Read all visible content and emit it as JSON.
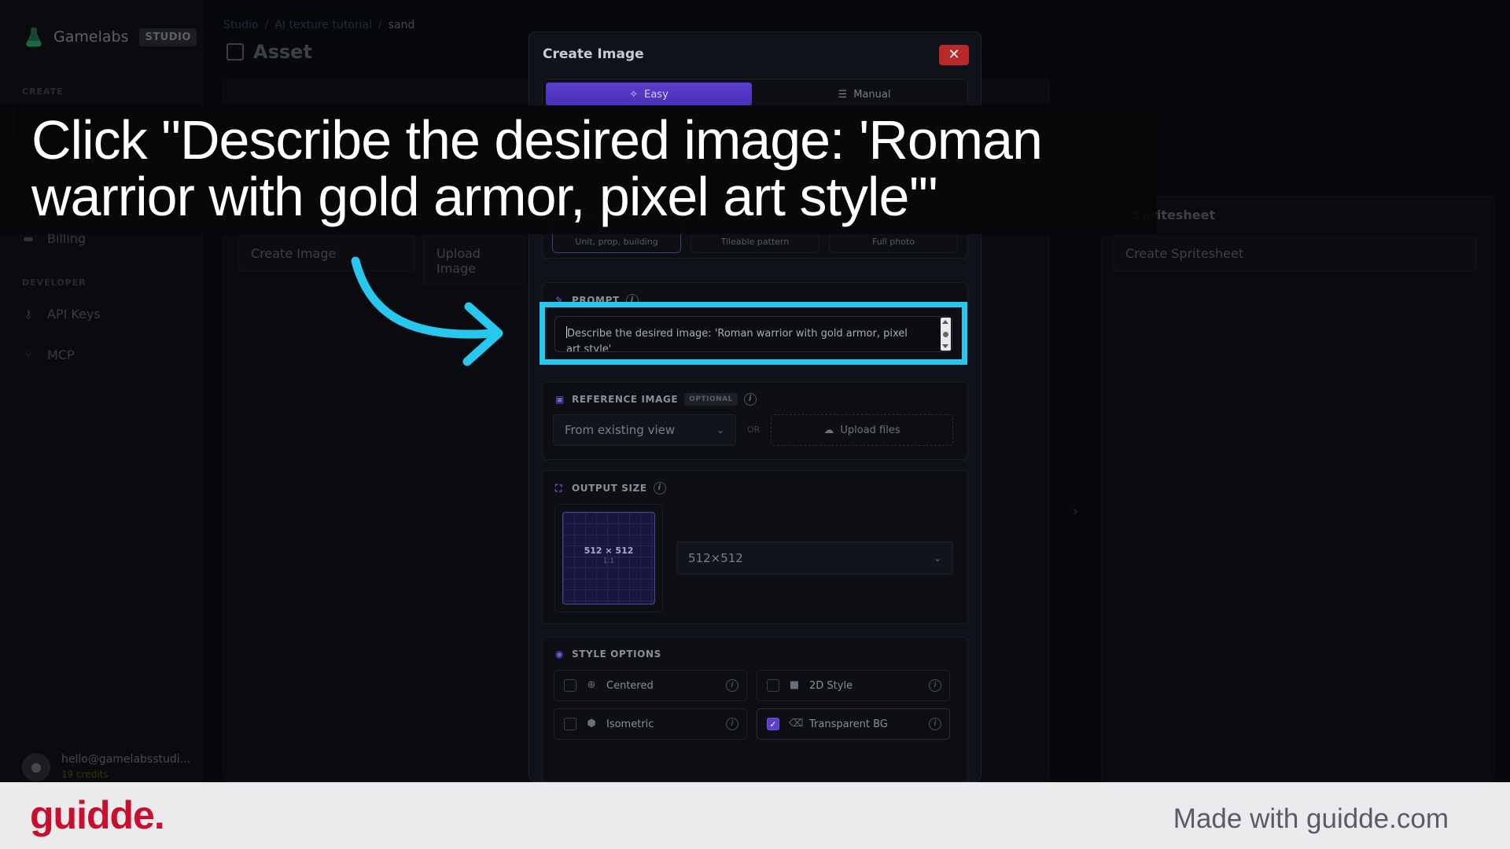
{
  "app": {
    "brand_name": "Gamelabs",
    "brand_badge": "STUDIO",
    "sections": {
      "create": "CREATE",
      "developer": "DEVELOPER"
    },
    "nav": [
      {
        "label": "Billing",
        "icon": "billing-icon"
      },
      {
        "label": "API Keys",
        "icon": "key-icon"
      },
      {
        "label": "MCP",
        "icon": "mcp-icon"
      }
    ],
    "user": {
      "email": "hello@gamelabsstudi...",
      "credits": "19 credits"
    }
  },
  "breadcrumb": [
    "Studio",
    "AI texture tutorial",
    "sand"
  ],
  "page_title": "Asset",
  "background": {
    "create_image": "Create Image",
    "upload_image": "Upload Image",
    "spritesheet_title": "Spritesheet",
    "create_spritesheet": "Create Spritesheet"
  },
  "modal": {
    "title": "Create Image",
    "close": "✕",
    "tabs": [
      {
        "label": "Easy",
        "icon": "magic-wand-icon",
        "active": true
      },
      {
        "label": "Manual",
        "icon": "sliders-icon",
        "active": false
      }
    ],
    "type_tiles": [
      {
        "sub": "Unit, prop, building"
      },
      {
        "sub": "Tileable pattern"
      },
      {
        "sub": "Full photo"
      }
    ],
    "prompt": {
      "label": "PROMPT",
      "value": "Describe the desired image: 'Roman warrior with gold armor, pixel art style'"
    },
    "reference": {
      "label": "REFERENCE IMAGE",
      "optional": "OPTIONAL",
      "select_value": "From existing view",
      "or": "OR",
      "upload": "Upload files"
    },
    "output_size": {
      "label": "OUTPUT SIZE",
      "preview_dims": "512 × 512",
      "preview_ratio": "1:1",
      "select_value": "512×512"
    },
    "style": {
      "label": "STYLE OPTIONS",
      "options": [
        {
          "label": "Centered",
          "icon": "crosshair-icon",
          "checked": false
        },
        {
          "label": "2D Style",
          "icon": "square-icon",
          "checked": false
        },
        {
          "label": "Isometric",
          "icon": "cube-icon",
          "checked": false
        },
        {
          "label": "Transparent BG",
          "icon": "eraser-icon",
          "checked": true
        }
      ]
    }
  },
  "guidde": {
    "caption": "Click \"Describe the desired image: 'Roman warrior with gold armor, pixel art style'\"",
    "logo": "guidde.",
    "made_with": "Made with guidde.com",
    "highlight_color": "#27c7ee",
    "logo_color": "#c8102e"
  }
}
